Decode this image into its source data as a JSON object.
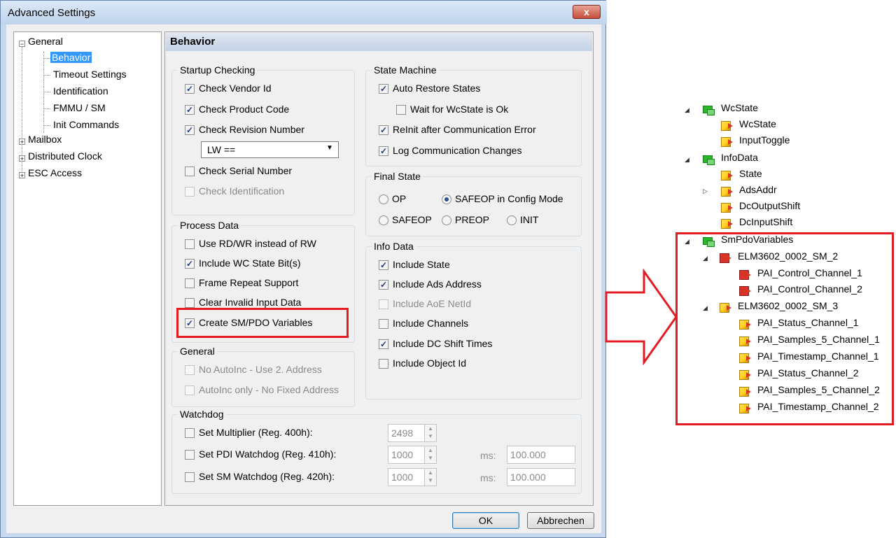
{
  "window": {
    "title": "Advanced Settings",
    "close": "x"
  },
  "tree": {
    "general": "General",
    "behavior": "Behavior",
    "timeout": "Timeout Settings",
    "identification": "Identification",
    "fmmu": "FMMU / SM",
    "init": "Init Commands",
    "mailbox": "Mailbox",
    "dc": "Distributed Clock",
    "esc": "ESC Access"
  },
  "panel": {
    "title": "Behavior"
  },
  "startup": {
    "label": "Startup Checking",
    "vendor": "Check Vendor Id",
    "product": "Check Product Code",
    "revision": "Check Revision Number",
    "revision_mode": "LW ==",
    "serial": "Check Serial Number",
    "ident": "Check Identification"
  },
  "state_machine": {
    "label": "State Machine",
    "auto_restore": "Auto Restore States",
    "wait_wc": "Wait for WcState is Ok",
    "reinit": "ReInit after Communication Error",
    "log": "Log Communication Changes"
  },
  "final_state": {
    "label": "Final State",
    "op": "OP",
    "safeop_cfg": "SAFEOP in Config Mode",
    "safeop": "SAFEOP",
    "preop": "PREOP",
    "init": "INIT"
  },
  "process_data": {
    "label": "Process Data",
    "rdwr": "Use RD/WR instead of RW",
    "wc": "Include WC State Bit(s)",
    "repeat": "Frame Repeat Support",
    "clear": "Clear Invalid Input Data",
    "create": "Create SM/PDO Variables"
  },
  "info_data": {
    "label": "Info Data",
    "state": "Include State",
    "ads": "Include Ads Address",
    "aoe": "Include AoE NetId",
    "channels": "Include Channels",
    "dc": "Include DC Shift Times",
    "objid": "Include Object Id"
  },
  "general_group": {
    "label": "General",
    "no_autoinc": "No AutoInc - Use 2. Address",
    "autoinc_only": "AutoInc only - No Fixed Address"
  },
  "watchdog": {
    "label": "Watchdog",
    "mult": "Set Multiplier (Reg. 400h):",
    "mult_val": "2498",
    "pdi": "Set PDI Watchdog (Reg. 410h):",
    "pdi_val": "1000",
    "pdi_ms_label": "ms:",
    "pdi_ms": "100.000",
    "sm": "Set SM Watchdog (Reg. 420h):",
    "sm_val": "1000",
    "sm_ms_label": "ms:",
    "sm_ms": "100.000"
  },
  "buttons": {
    "ok": "OK",
    "cancel": "Abbrechen"
  },
  "right_tree": {
    "wcstate": "WcState",
    "wcstate_var": "WcState",
    "inputtoggle": "InputToggle",
    "infodata": "InfoData",
    "state": "State",
    "adsaddr": "AdsAddr",
    "dcoutput": "DcOutputShift",
    "dcinput": "DcInputShift",
    "smpdo": "SmPdoVariables",
    "sm2": "ELM3602_0002_SM_2",
    "ctrl1": "PAI_Control_Channel_1",
    "ctrl2": "PAI_Control_Channel_2",
    "sm3": "ELM3602_0002_SM_3",
    "st1": "PAI_Status_Channel_1",
    "samp1": "PAI_Samples_5_Channel_1",
    "ts1": "PAI_Timestamp_Channel_1",
    "st2": "PAI_Status_Channel_2",
    "samp2": "PAI_Samples_5_Channel_2",
    "ts2": "PAI_Timestamp_Channel_2"
  },
  "colors": {
    "highlight": "#e31b23",
    "selection": "#3399ff"
  }
}
